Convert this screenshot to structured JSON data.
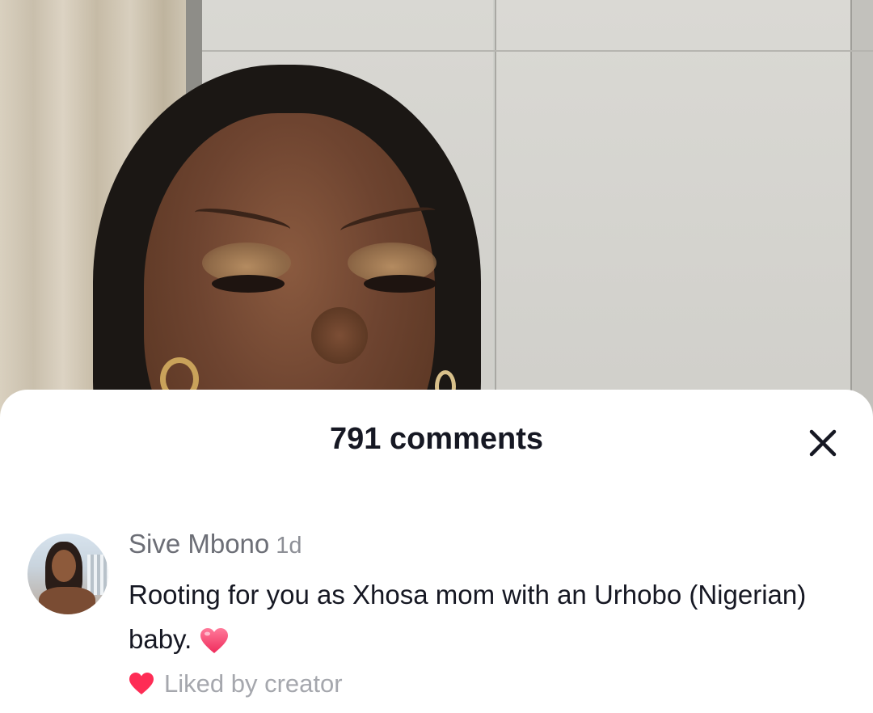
{
  "video": {
    "subject": "person-portrait"
  },
  "comments_sheet": {
    "title": "791 comments",
    "close_icon": "close-icon"
  },
  "comment": {
    "author": "Sive Mbono",
    "time": "1d",
    "text": "Rooting for you as Xhosa mom with an Urhobo (Nigerian) baby.",
    "emoji": "heart-emoji",
    "liked_by": "Liked by creator",
    "liked_icon": "heart-icon"
  },
  "colors": {
    "title": "#161823",
    "author": "#6c6e76",
    "secondary": "#a5a7ad",
    "heart": "#fe2c55"
  }
}
